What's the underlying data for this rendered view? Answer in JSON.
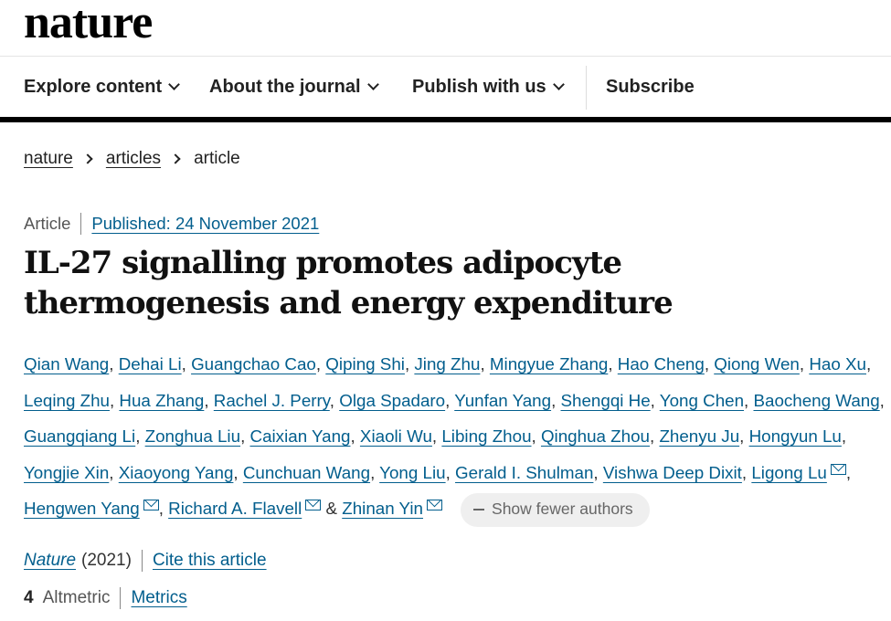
{
  "header": {
    "logo": "nature"
  },
  "nav": {
    "explore": "Explore content",
    "about": "About the journal",
    "publish": "Publish with us",
    "subscribe": "Subscribe"
  },
  "breadcrumb": {
    "home": "nature",
    "section": "articles",
    "current": "article"
  },
  "article": {
    "type": "Article",
    "published": "Published: 24 November 2021",
    "title": "IL-27 signalling promotes adipocyte thermogenesis and energy expenditure",
    "authors": [
      "Qian Wang",
      "Dehai Li",
      "Guangchao Cao",
      "Qiping Shi",
      "Jing Zhu",
      "Mingyue Zhang",
      "Hao Cheng",
      "Qiong Wen",
      "Hao Xu",
      "Leqing Zhu",
      "Hua Zhang",
      "Rachel J. Perry",
      "Olga Spadaro",
      "Yunfan Yang",
      "Shengqi He",
      "Yong Chen",
      "Baocheng Wang",
      "Guangqiang Li",
      "Zonghua Liu",
      "Caixian Yang",
      "Xiaoli Wu",
      "Libing Zhou",
      "Qinghua Zhou",
      "Zhenyu Ju",
      "Hongyun Lu",
      "Yongjie Xin",
      "Xiaoyong Yang",
      "Cunchuan Wang",
      "Yong Liu",
      "Gerald I. Shulman",
      "Vishwa Deep Dixit",
      "Ligong Lu",
      "Hengwen Yang",
      "Richard A. Flavell",
      "Zhinan Yin"
    ],
    "corresponding_authors": [
      "Ligong Lu",
      "Hengwen Yang",
      "Richard A. Flavell",
      "Zhinan Yin"
    ],
    "ampersand": "&",
    "show_fewer": "Show fewer authors",
    "journal": "Nature",
    "year": "(2021)",
    "cite": "Cite this article",
    "altmetric_count": "4",
    "altmetric_label": "Altmetric",
    "metrics": "Metrics"
  },
  "colors": {
    "link": "#025e8d",
    "text": "#222222",
    "navbar_bottom": "#000000"
  }
}
